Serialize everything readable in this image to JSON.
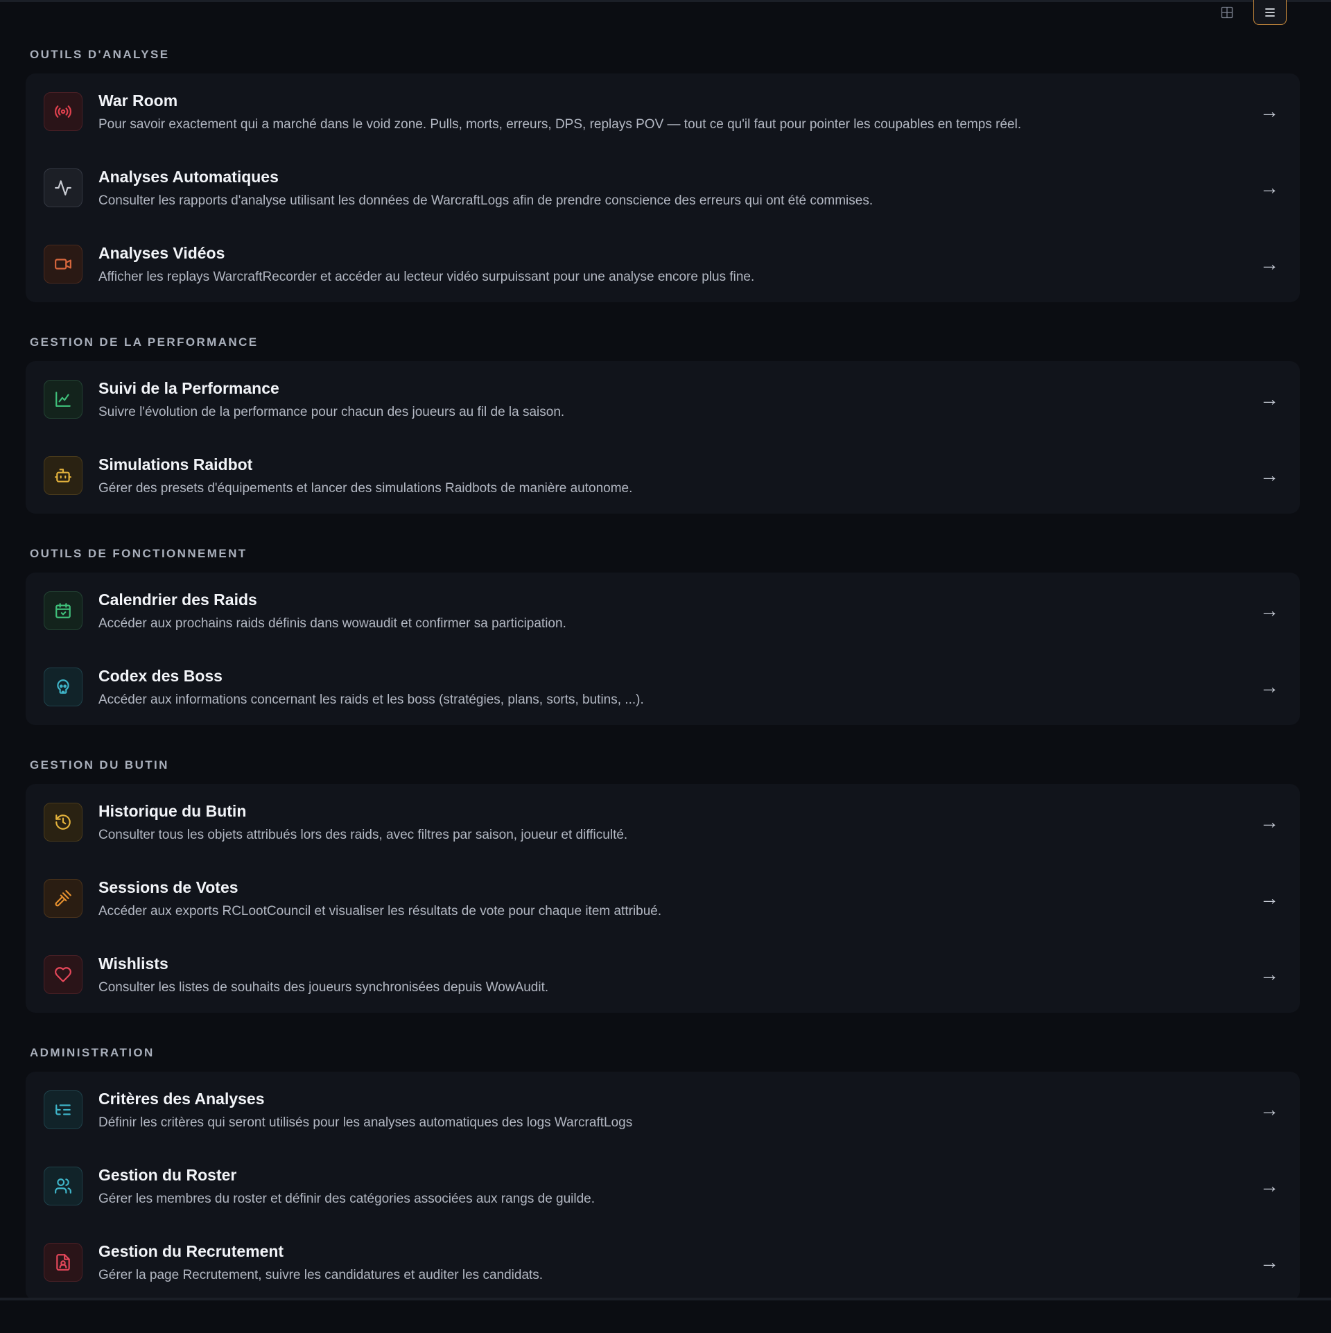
{
  "sections": [
    {
      "title": "OUTILS D'ANALYSE",
      "items": [
        {
          "title": "War Room",
          "desc": "Pour savoir exactement qui a marché dans le void zone. Pulls, morts, erreurs, DPS, replays POV — tout ce qu'il faut pour pointer les coupables en temps réel.",
          "icon": "radio-icon",
          "color": "#e0414e"
        },
        {
          "title": "Analyses Automatiques",
          "desc": "Consulter les rapports d'analyse utilisant les données de WarcraftLogs afin de prendre conscience des erreurs qui ont été commises.",
          "icon": "activity-icon",
          "color": "#c9ccd3"
        },
        {
          "title": "Analyses Vidéos",
          "desc": "Afficher les replays WarcraftRecorder et accéder au lecteur vidéo surpuissant pour une analyse encore plus fine.",
          "icon": "video-icon",
          "color": "#d8673d"
        }
      ]
    },
    {
      "title": "GESTION DE LA PERFORMANCE",
      "items": [
        {
          "title": "Suivi de la Performance",
          "desc": "Suivre l'évolution de la performance pour chacun des joueurs au fil de la saison.",
          "icon": "line-chart-icon",
          "color": "#3fbf7a"
        },
        {
          "title": "Simulations Raidbot",
          "desc": "Gérer des presets d'équipements et lancer des simulations Raidbots de manière autonome.",
          "icon": "bot-icon",
          "color": "#e3b23c"
        }
      ]
    },
    {
      "title": "OUTILS DE FONCTIONNEMENT",
      "items": [
        {
          "title": "Calendrier des Raids",
          "desc": "Accéder aux prochains raids définis dans wowaudit et confirmer sa participation.",
          "icon": "calendar-icon",
          "color": "#3fbf7a"
        },
        {
          "title": "Codex des Boss",
          "desc": "Accéder aux informations concernant les raids et les boss (stratégies, plans, sorts, butins, ...).",
          "icon": "skull-icon",
          "color": "#3fb5c9"
        }
      ]
    },
    {
      "title": "GESTION DU BUTIN",
      "items": [
        {
          "title": "Historique du Butin",
          "desc": "Consulter tous les objets attribués lors des raids, avec filtres par saison, joueur et difficulté.",
          "icon": "history-icon",
          "color": "#e3b23c"
        },
        {
          "title": "Sessions de Votes",
          "desc": "Accéder aux exports RCLootCouncil et visualiser les résultats de vote pour chaque item attribué.",
          "icon": "gavel-icon",
          "color": "#e5902f"
        },
        {
          "title": "Wishlists",
          "desc": "Consulter les listes de souhaits des joueurs synchronisées depuis WowAudit.",
          "icon": "heart-icon",
          "color": "#e5475a"
        }
      ]
    },
    {
      "title": "ADMINISTRATION",
      "items": [
        {
          "title": "Critères des Analyses",
          "desc": "Définir les critères qui seront utilisés pour les analyses automatiques des logs WarcraftLogs",
          "icon": "list-tree-icon",
          "color": "#3fb5c9"
        },
        {
          "title": "Gestion du Roster",
          "desc": "Gérer les membres du roster et définir des catégories associées aux rangs de guilde.",
          "icon": "users-icon",
          "color": "#3fb5c9"
        },
        {
          "title": "Gestion du Recrutement",
          "desc": "Gérer la page Recrutement, suivre les candidatures et auditer les candidats.",
          "icon": "file-user-icon",
          "color": "#e5475a"
        }
      ]
    }
  ],
  "arrow": "→"
}
